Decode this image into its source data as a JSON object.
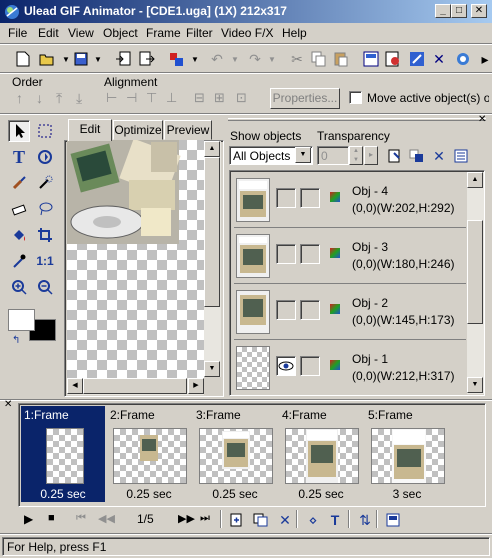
{
  "window": {
    "title": "Ulead GIF Animator - [CDE1.uga] (1X) 212x317",
    "minimize": "_",
    "maximize": "□",
    "close": "✕"
  },
  "menu": [
    "File",
    "Edit",
    "View",
    "Object",
    "Frame",
    "Filter",
    "Video F/X",
    "Help"
  ],
  "object_bar": {
    "order_label": "Order",
    "alignment_label": "Alignment",
    "properties_button": "Properties...",
    "move_active_label": "Move active object(s) onl"
  },
  "canvas_tabs": [
    "Edit",
    "Optimize",
    "Preview"
  ],
  "object_panel": {
    "show_objects_label": "Show objects",
    "transparency_label": "Transparency",
    "show_objects_value": "All Objects",
    "transparency_value": "0",
    "objects": [
      {
        "name": "Obj - 4",
        "dims": "(0,0)(W:202,H:292)",
        "visible": false
      },
      {
        "name": "Obj - 3",
        "dims": "(0,0)(W:180,H:246)",
        "visible": false
      },
      {
        "name": "Obj - 2",
        "dims": "(0,0)(W:145,H:173)",
        "visible": false
      },
      {
        "name": "Obj - 1",
        "dims": "(0,0)(W:212,H:317)",
        "visible": true
      }
    ]
  },
  "frames": [
    {
      "label": "1:Frame",
      "delay": "0.25 sec",
      "selected": true
    },
    {
      "label": "2:Frame",
      "delay": "0.25 sec",
      "selected": false
    },
    {
      "label": "3:Frame",
      "delay": "0.25 sec",
      "selected": false
    },
    {
      "label": "4:Frame",
      "delay": "0.25 sec",
      "selected": false
    },
    {
      "label": "5:Frame",
      "delay": "3 sec",
      "selected": false
    }
  ],
  "playback": {
    "frame_counter": "1/5"
  },
  "status": {
    "text": "For Help, press F1"
  },
  "colors": {
    "title_start": "#0a246a",
    "title_end": "#a6caf0",
    "selection": "#0a246a",
    "face": "#d4d0c8"
  }
}
